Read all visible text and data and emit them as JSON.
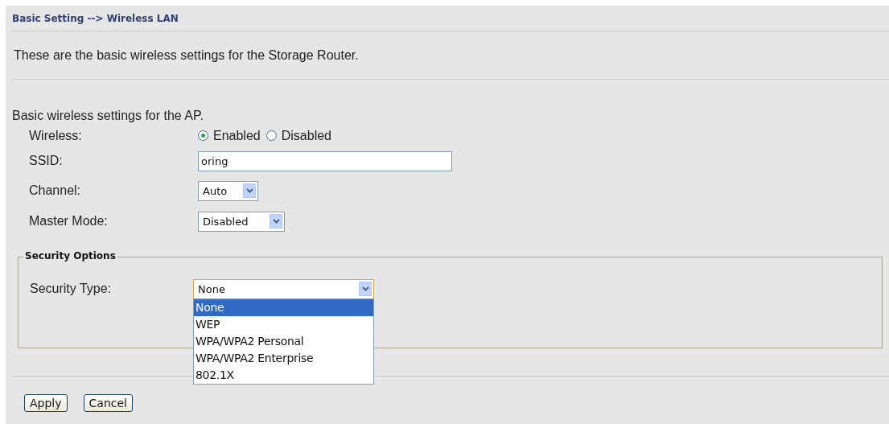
{
  "header": {
    "title": "Basic Setting --> Wireless LAN"
  },
  "description": "These are the basic wireless settings for the Storage Router.",
  "section_heading": "Basic wireless settings for the AP.",
  "wireless": {
    "label": "Wireless:",
    "options": [
      {
        "label": "Enabled",
        "selected": true
      },
      {
        "label": "Disabled",
        "selected": false
      }
    ]
  },
  "ssid": {
    "label": "SSID:",
    "value": "oring"
  },
  "channel": {
    "label": "Channel:",
    "value": "Auto"
  },
  "master_mode": {
    "label": "Master Mode:",
    "value": "Disabled"
  },
  "security": {
    "legend": "Security Options",
    "label": "Security Type:",
    "value": "None",
    "expanded": true,
    "options": [
      {
        "label": "None",
        "selected": true
      },
      {
        "label": "WEP",
        "selected": false
      },
      {
        "label": "WPA/WPA2 Personal",
        "selected": false
      },
      {
        "label": "WPA/WPA2 Enterprise",
        "selected": false
      },
      {
        "label": "802.1X",
        "selected": false
      }
    ]
  },
  "buttons": [
    "Apply",
    "Cancel"
  ]
}
